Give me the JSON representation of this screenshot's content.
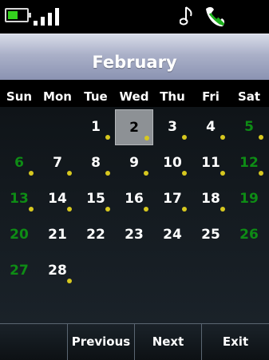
{
  "status": {
    "battery_icon": "battery-icon",
    "signal_icon": "signal-strength-icon",
    "music_icon": "music-note-icon",
    "handset_icon": "handset-icon"
  },
  "header": {
    "title": "February"
  },
  "weekdays": [
    "Sun",
    "Mon",
    "Tue",
    "Wed",
    "Thu",
    "Fri",
    "Sat"
  ],
  "calendar": {
    "selected_day": "2",
    "weeks": [
      [
        null,
        null,
        {
          "day": "1",
          "dot": true
        },
        {
          "day": "2",
          "dot": true,
          "selected": true
        },
        {
          "day": "3",
          "dot": true
        },
        {
          "day": "4",
          "dot": true
        },
        {
          "day": "5",
          "dot": true,
          "weekend": true
        }
      ],
      [
        {
          "day": "6",
          "dot": true,
          "weekend": true
        },
        {
          "day": "7",
          "dot": true
        },
        {
          "day": "8",
          "dot": true
        },
        {
          "day": "9",
          "dot": true
        },
        {
          "day": "10",
          "dot": true
        },
        {
          "day": "11",
          "dot": true
        },
        {
          "day": "12",
          "dot": true,
          "weekend": true
        }
      ],
      [
        {
          "day": "13",
          "dot": true,
          "weekend": true
        },
        {
          "day": "14",
          "dot": true
        },
        {
          "day": "15",
          "dot": true
        },
        {
          "day": "16",
          "dot": true
        },
        {
          "day": "17",
          "dot": true
        },
        {
          "day": "18",
          "dot": true
        },
        {
          "day": "19",
          "weekend": true
        }
      ],
      [
        {
          "day": "20",
          "weekend": true
        },
        {
          "day": "21"
        },
        {
          "day": "22"
        },
        {
          "day": "23"
        },
        {
          "day": "24"
        },
        {
          "day": "25"
        },
        {
          "day": "26",
          "weekend": true
        }
      ],
      [
        {
          "day": "27",
          "weekend": true
        },
        {
          "day": "28",
          "dot": true
        },
        null,
        null,
        null,
        null,
        null
      ]
    ],
    "colors": {
      "weekend": "#0e8c15",
      "event_dot": "#d7c81f",
      "selected_bg": "#8d9195"
    }
  },
  "softkeys": {
    "left": "",
    "previous": "Previous",
    "next": "Next",
    "exit": "Exit"
  }
}
